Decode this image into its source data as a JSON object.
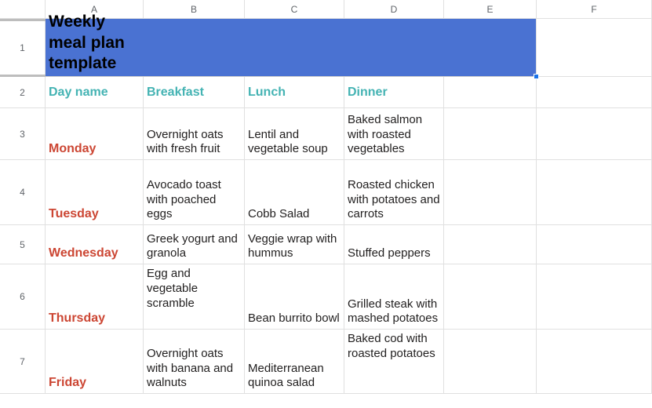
{
  "columns": [
    "A",
    "B",
    "C",
    "D",
    "E",
    "F"
  ],
  "rows": [
    "1",
    "2",
    "3",
    "4",
    "5",
    "6",
    "7"
  ],
  "title": "Weekly meal plan template",
  "headers": {
    "day": "Day name",
    "breakfast": "Breakfast",
    "lunch": "Lunch",
    "dinner": "Dinner"
  },
  "meals": [
    {
      "day": "Monday",
      "breakfast": "Overnight oats with fresh fruit",
      "lunch": "Lentil and vegetable soup",
      "dinner": "Baked salmon with roasted vegetables"
    },
    {
      "day": "Tuesday",
      "breakfast": "Avocado toast with poached eggs",
      "lunch": "Cobb Salad",
      "dinner": "Roasted chicken with potatoes and carrots"
    },
    {
      "day": "Wednesday",
      "breakfast": "Greek yogurt and granola",
      "lunch": "Veggie wrap with hummus",
      "dinner": "Stuffed peppers"
    },
    {
      "day": "Thursday",
      "breakfast": "Egg and vegetable scramble",
      "lunch": "Bean burrito bowl",
      "dinner": "Grilled steak with mashed potatoes"
    },
    {
      "day": "Friday",
      "breakfast": "Overnight oats with banana and walnuts",
      "lunch": "Mediterranean quinoa salad",
      "dinner": "Baked cod with roasted potatoes"
    }
  ]
}
